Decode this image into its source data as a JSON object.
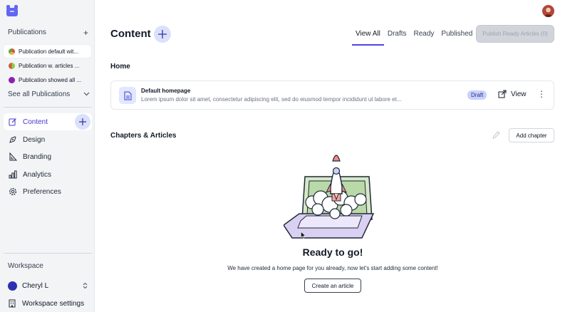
{
  "sidebar": {
    "publications_label": "Publications",
    "add_icon": "plus-icon",
    "publications": [
      {
        "name": "Publication default wit...",
        "color": "#c2902b"
      },
      {
        "name": "Publication w. articles ...",
        "color": "#6cac3a"
      },
      {
        "name": "Publication showed all ...",
        "color": "#8e1fb0"
      }
    ],
    "see_all_label": "See all Publications",
    "nav": [
      {
        "label": "Content",
        "icon": "edit-icon"
      },
      {
        "label": "Design",
        "icon": "pen-tool-icon"
      },
      {
        "label": "Branding",
        "icon": "brand-icon"
      },
      {
        "label": "Analytics",
        "icon": "bar-chart-icon"
      },
      {
        "label": "Preferences",
        "icon": "gear-icon"
      }
    ],
    "workspace_label": "Workspace",
    "user_name": "Cheryl L",
    "workspace_settings_label": "Workspace settings"
  },
  "header": {
    "title": "Content",
    "tabs": [
      "View All",
      "Drafts",
      "Ready",
      "Published"
    ],
    "active_tab": "View All",
    "publish_button": "Publish Ready Articles (0)"
  },
  "home": {
    "heading": "Home",
    "card_title": "Default homepage",
    "card_desc": "Lorem ipsum dolor sit amet, consectetur adipiscing elit, sed do eiusmod tempor incididunt ut labore et...",
    "badge": "Draft",
    "view_label": "View"
  },
  "chapters": {
    "heading": "Chapters & Articles",
    "add_chapter": "Add chapter"
  },
  "empty_state": {
    "title": "Ready to go!",
    "subtitle": "We have created a home page for you already, now let's start adding some content!",
    "button": "Create an article"
  },
  "colors": {
    "accent": "#4f46e5",
    "accent_soft": "#dbe1fb",
    "draft_badge": "#c7d2fe"
  }
}
